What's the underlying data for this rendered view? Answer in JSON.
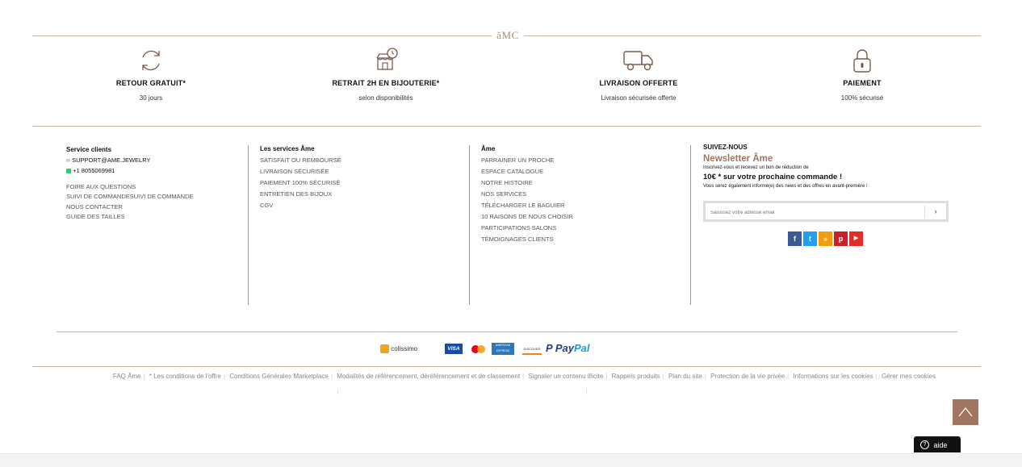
{
  "brand": {
    "logo_text": "ăMC"
  },
  "features": [
    {
      "icon": "refresh-icon",
      "title": "RETOUR GRATUIT*",
      "subtitle": "30 jours"
    },
    {
      "icon": "store-clock-icon",
      "title": "RETRAIT 2H EN BIJOUTERIE*",
      "subtitle": "selon disponibilités"
    },
    {
      "icon": "truck-icon",
      "title": "LIVRAISON OFFERTE",
      "subtitle": "Livraison sécurisée offerte"
    },
    {
      "icon": "lock-icon",
      "title": "PAIEMENT",
      "subtitle": "100% sécurisé"
    }
  ],
  "service_clients": {
    "title": "Service clients",
    "email": "SUPPORT@AME.JEWELRY",
    "phone": "+1 8055069981",
    "links": [
      "FOIRE AUX QUESTIONS",
      "SUIVI DE COMMANDESUIVI DE COMMANDE",
      "NOUS CONTACTER",
      "GUIDE DES TAILLES"
    ]
  },
  "services": {
    "title": "Les services Âme",
    "links": [
      "SATISFAIT OU REMBOURSÉ",
      "LIVRAISON SÉCURISÉE",
      "PAIEMENT 100% SÉCURISÉ",
      "ENTRETIEN DES BIJOUX",
      "CGV"
    ]
  },
  "ame": {
    "title": "Âme",
    "links": [
      "PARRAINER UN PROCHE",
      "ESPACE CATALOGUE",
      "NOTRE HISTOIRE",
      "NOS SERVICES",
      "TÉLÉCHARGER LE BAGUIER",
      "10 RAISONS DE NOUS CHOISIR",
      "PARTICIPATIONS SALONS",
      "TÉMOIGNAGES CLIENTS"
    ]
  },
  "newsletter": {
    "follow": "SUIVEZ-NOUS",
    "title": "Newsletter Âme",
    "line1": "Inscrivez-vous et recevez un bon de réduction de",
    "offer": "10€ * sur votre prochaine commande !",
    "line2": "Vous serez également informé(e) des news et des offres en avant-première !",
    "placeholder": "Saisissez votre adresse email",
    "submit": "›"
  },
  "social": [
    {
      "name": "facebook-icon",
      "glyph": "f",
      "color": "#3b5998"
    },
    {
      "name": "twitter-icon",
      "glyph": "t",
      "color": "#1da1f2"
    },
    {
      "name": "rss-icon",
      "glyph": "»",
      "color": "#f39c12"
    },
    {
      "name": "pinterest-icon",
      "glyph": "p",
      "color": "#cb2027"
    },
    {
      "name": "youtube-icon",
      "glyph": "▶",
      "color": "#e52d27"
    }
  ],
  "payments": {
    "colissimo": "colissimo",
    "visa": "VISA",
    "amex": "AMERICAN EXPRESS",
    "discover": "DISCOVER",
    "paypal_pay": "Pay",
    "paypal_pal": "Pal"
  },
  "legal_links": [
    "FAQ Âme",
    "* Les conditions de l'offre",
    "Conditions Générales Marketplace",
    "Modalités de référencement, déréférencement et de classement",
    "Signaler un contenu illicite",
    "Rappels produits",
    "Plan du site",
    "Protection de la vie privée",
    "Informations sur les cookies",
    "Gérer mes cookies"
  ],
  "help": {
    "label": "aide"
  },
  "colors": {
    "accent": "#a07660",
    "line": "#c9b2a2"
  }
}
